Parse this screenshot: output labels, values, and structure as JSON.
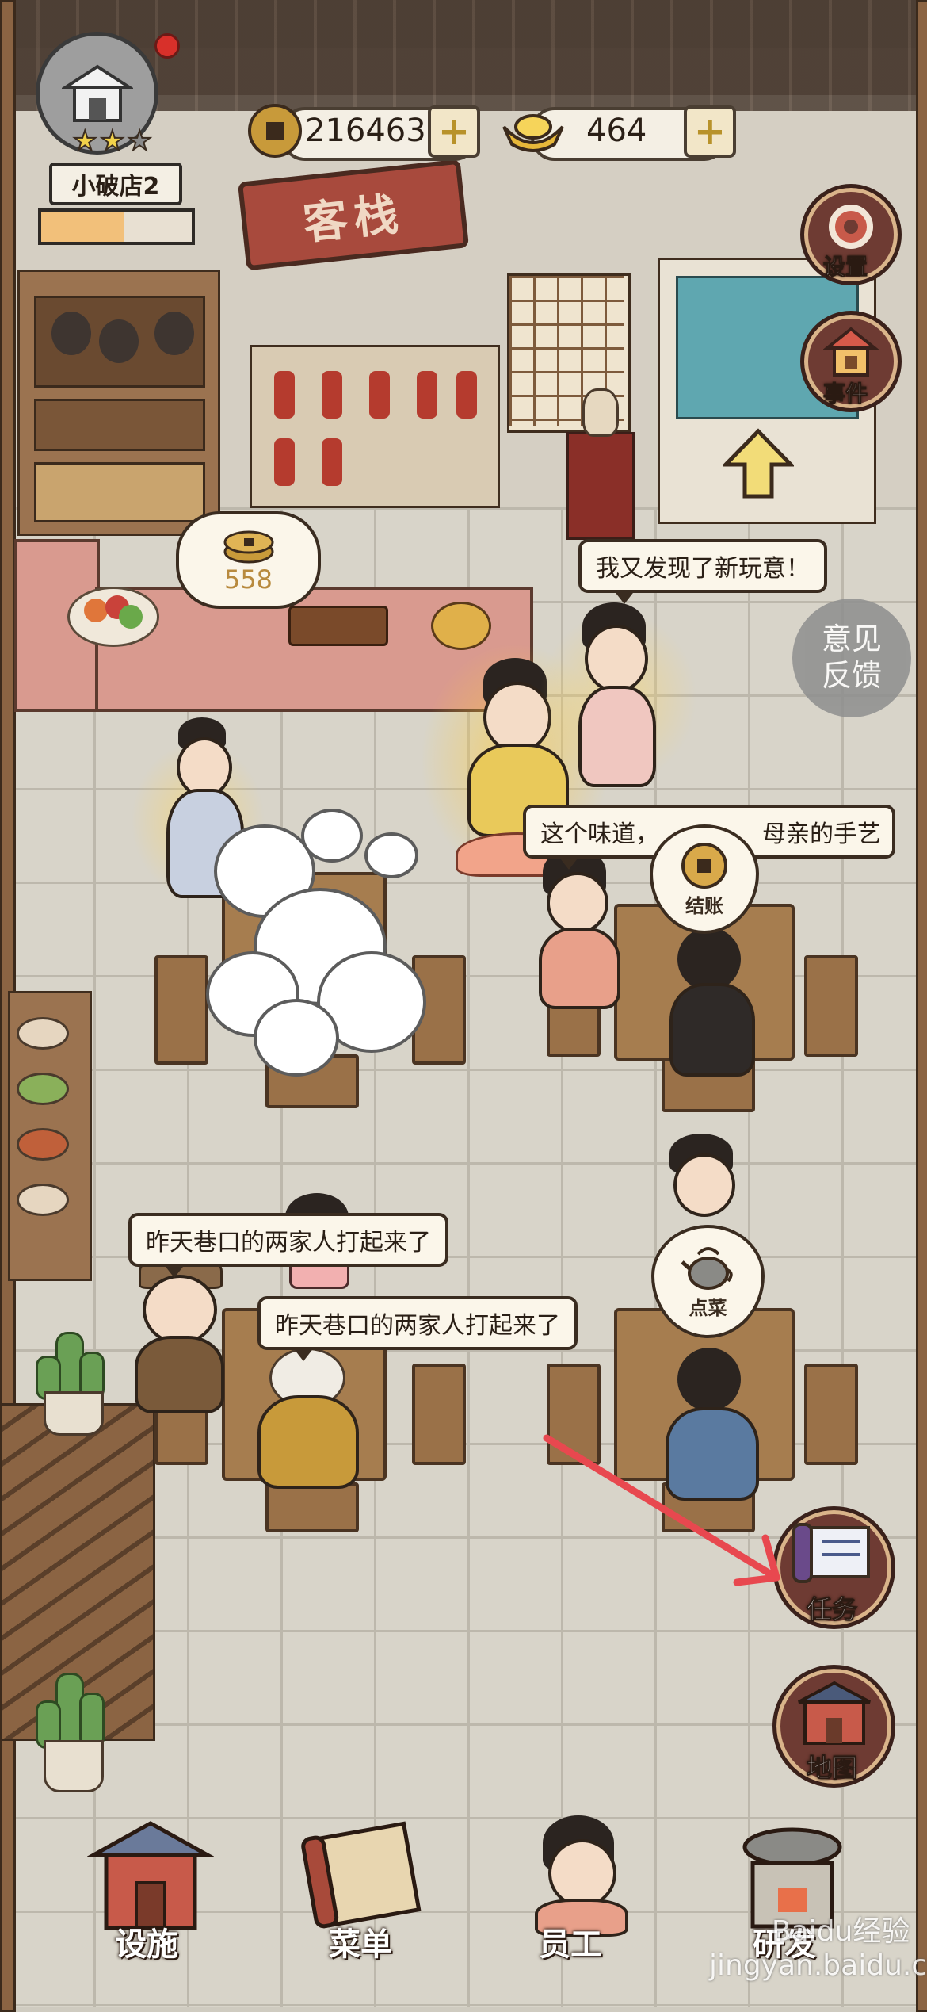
{
  "shop": {
    "name": "小破店2",
    "stars": 2,
    "level_progress": 0.55
  },
  "currency": {
    "copper": {
      "icon": "copper-coin-icon",
      "value": "216463",
      "add": "+"
    },
    "gold": {
      "icon": "gold-ingot-icon",
      "value": "464",
      "add": "+"
    }
  },
  "signboard": "客栈",
  "side_buttons": {
    "settings": {
      "icon": "gear-icon",
      "label": "设置"
    },
    "events": {
      "icon": "house-icon",
      "label": "事件"
    },
    "feedback": {
      "label": "意见\n反馈"
    },
    "tasks": {
      "icon": "scroll-icon",
      "label": "任务"
    },
    "map": {
      "icon": "map-icon",
      "label": "地图"
    }
  },
  "counter_reward": {
    "icon": "coins-icon",
    "value": "558"
  },
  "bubbles": {
    "new_item": "我又发现了新玩意！",
    "taste": "这个味道，",
    "taste_end": "母亲的手艺",
    "gossip_1": "昨天巷口的两家人打起来了",
    "gossip_2": "昨天巷口的两家人打起来了"
  },
  "actions": {
    "checkout": {
      "icon": "coin-icon",
      "label": "结账"
    },
    "order": {
      "icon": "teapot-icon",
      "label": "点菜"
    }
  },
  "bottom_nav": [
    {
      "label": "设施",
      "icon": "building-icon"
    },
    {
      "label": "菜单",
      "icon": "menu-scroll-icon"
    },
    {
      "label": "员工",
      "icon": "staff-icon"
    },
    {
      "label": "研发",
      "icon": "stove-icon"
    }
  ],
  "watermark": "Baidu经验\njingyan.baidu.com",
  "colors": {
    "arrow": "#e8484f",
    "notification": "#d8302a",
    "progress": "#f2c07a"
  }
}
